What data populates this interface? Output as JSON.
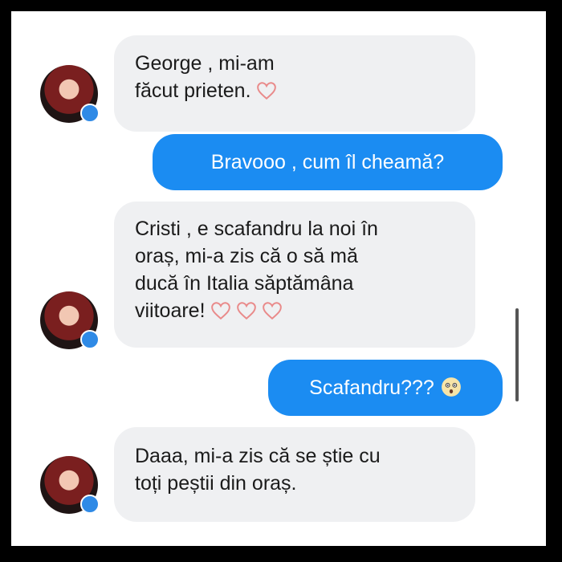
{
  "messages": [
    {
      "side": "incoming",
      "lines": [
        "George , mi-am",
        "făcut prieten."
      ],
      "hearts": 1
    },
    {
      "side": "outgoing",
      "lines": [
        "Bravooo , cum  îl cheamă?"
      ]
    },
    {
      "side": "incoming",
      "lines": [
        "Cristi , e scafandru la noi în",
        "oraș, mi-a zis că o să mă",
        "ducă în Italia săptămâna",
        "viitoare!"
      ],
      "hearts": 3
    },
    {
      "side": "outgoing",
      "lines": [
        "Scafandru???"
      ],
      "emoji": "astonished-face-icon"
    },
    {
      "side": "incoming",
      "lines": [
        "Daaa, mi-a zis că se știe cu",
        "toți peștii din oraș."
      ]
    }
  ],
  "colors": {
    "outgoing_bubble": "#1b8cf2",
    "incoming_bubble": "#eff0f2",
    "heart": "#e98a8a",
    "badge": "#2f8ae6"
  }
}
